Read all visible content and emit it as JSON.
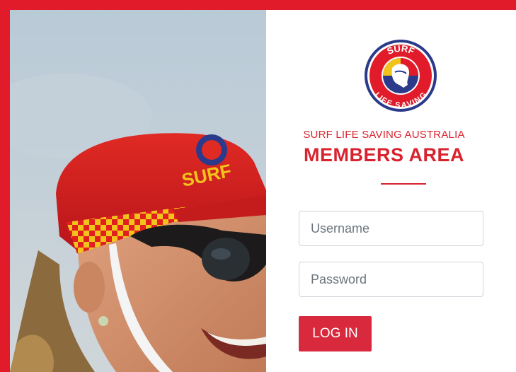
{
  "header": {
    "org_name": "SURF LIFE SAVING AUSTRALIA",
    "area_title": "MEMBERS AREA"
  },
  "logo": {
    "text_top": "SURF",
    "text_bottom": "LIFE SAVING"
  },
  "photo": {
    "cap_text": "SURF"
  },
  "login_form": {
    "username_placeholder": "Username",
    "password_placeholder": "Password",
    "submit_label": "LOG IN"
  },
  "colors": {
    "brand_red": "#d8232f",
    "border_red": "#e11b2a",
    "button_red": "#d8293d",
    "cap_yellow": "#f2c31a"
  }
}
